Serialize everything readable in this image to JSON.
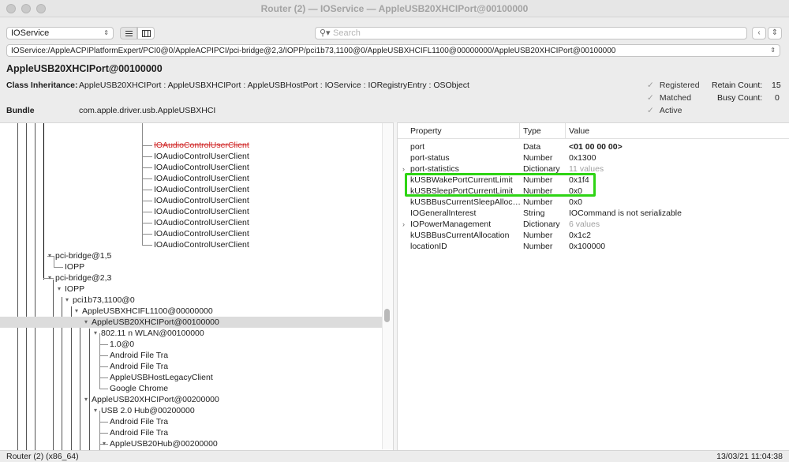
{
  "window": {
    "title": "Router (2) — IOService — AppleUSB20XHCIPort@00100000"
  },
  "toolbar": {
    "plane_select": "IOService",
    "search_placeholder": "Search",
    "path": "IOService:/AppleACPIPlatformExpert/PCI0@0/AppleACPIPCI/pci-bridge@2,3/IOPP/pci1b73,1100@0/AppleUSBXHCIFL1100@00000000/AppleUSB20XHCIPort@00100000"
  },
  "info": {
    "object_name": "AppleUSB20XHCIPort@00100000",
    "class_label": "Class Inheritance:",
    "class_value": "AppleUSB20XHCIPort : AppleUSBXHCIPort : AppleUSBHostPort : IOService : IORegistryEntry : OSObject",
    "bundle_label": "Bundle",
    "bundle_value": "com.apple.driver.usb.AppleUSBXHCI",
    "registered": "Registered",
    "matched": "Matched",
    "active": "Active",
    "retain_label": "Retain Count:",
    "retain_value": "15",
    "busy_label": "Busy Count:",
    "busy_value": "0"
  },
  "tree": [
    {
      "text": "IOAudioControlUserClient",
      "strike": true
    },
    {
      "text": "IOAudioControlUserClient"
    },
    {
      "text": "IOAudioControlUserClient"
    },
    {
      "text": "IOAudioControlUserClient"
    },
    {
      "text": "IOAudioControlUserClient"
    },
    {
      "text": "IOAudioControlUserClient"
    },
    {
      "text": "IOAudioControlUserClient"
    },
    {
      "text": "IOAudioControlUserClient"
    },
    {
      "text": "IOAudioControlUserClient"
    },
    {
      "text": "IOAudioControlUserClient"
    },
    {
      "text": "pci-bridge@1,5"
    },
    {
      "text": "IOPP"
    },
    {
      "text": "pci-bridge@2,3"
    },
    {
      "text": "IOPP"
    },
    {
      "text": "pci1b73,1100@0"
    },
    {
      "text": "AppleUSBXHCIFL1100@00000000"
    },
    {
      "text": "AppleUSB20XHCIPort@00100000",
      "selected": true
    },
    {
      "text": "802.11 n WLAN@00100000"
    },
    {
      "text": "1.0@0"
    },
    {
      "text": "Android File Tra"
    },
    {
      "text": "Android File Tra"
    },
    {
      "text": "AppleUSBHostLegacyClient"
    },
    {
      "text": "Google Chrome"
    },
    {
      "text": "AppleUSB20XHCIPort@00200000"
    },
    {
      "text": "USB 2.0 Hub@00200000"
    },
    {
      "text": "Android File Tra"
    },
    {
      "text": "Android File Tra"
    },
    {
      "text": "AppleUSB20Hub@00200000"
    }
  ],
  "properties": {
    "headers": {
      "property": "Property",
      "type": "Type",
      "value": "Value"
    },
    "rows": [
      {
        "property": "port",
        "type": "Data",
        "value": "<01 00 00 00>",
        "bold": true
      },
      {
        "property": "port-status",
        "type": "Number",
        "value": "0x1300"
      },
      {
        "property": "port-statistics",
        "type": "Dictionary",
        "value": "11 values",
        "expand": true,
        "gray": true
      },
      {
        "property": "kUSBWakePortCurrentLimit",
        "type": "Number",
        "value": "0x1f4"
      },
      {
        "property": "kUSBSleepPortCurrentLimit",
        "type": "Number",
        "value": "0x0"
      },
      {
        "property": "kUSBBusCurrentSleepAlloc…",
        "type": "Number",
        "value": "0x0"
      },
      {
        "property": "IOGeneralInterest",
        "type": "String",
        "value": "IOCommand is not serializable"
      },
      {
        "property": "IOPowerManagement",
        "type": "Dictionary",
        "value": "6 values",
        "expand": true,
        "gray": true
      },
      {
        "property": "kUSBBusCurrentAllocation",
        "type": "Number",
        "value": "0x1c2"
      },
      {
        "property": "locationID",
        "type": "Number",
        "value": "0x100000"
      }
    ]
  },
  "status": {
    "left": "Router (2) (x86_64)",
    "right": "13/03/21 11:04:38"
  },
  "colors": {
    "highlight": "#2ed414",
    "strike": "#d12b2b"
  }
}
